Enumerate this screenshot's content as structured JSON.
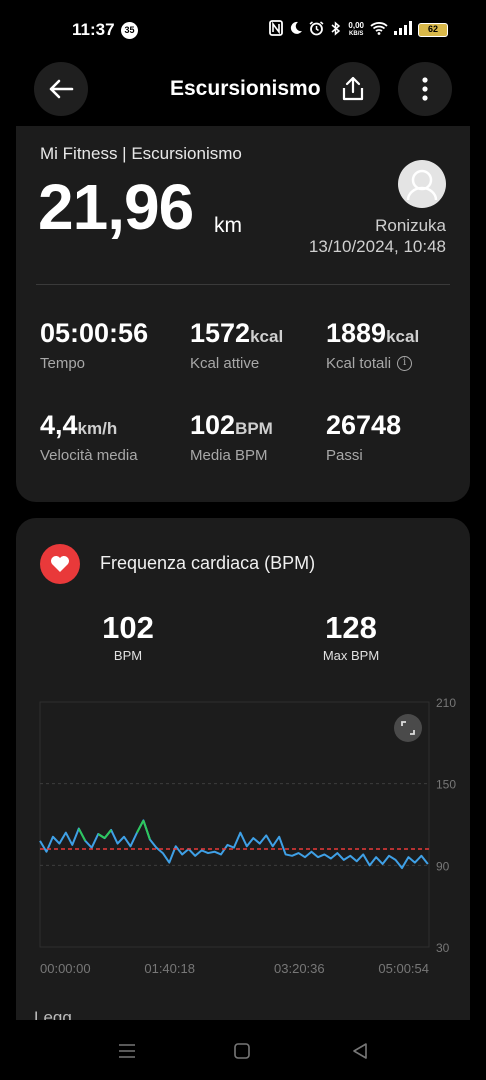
{
  "status_bar": {
    "time": "11:37",
    "notification_count": "35",
    "net_speed_value": "0,00",
    "net_speed_unit": "KB/S",
    "battery": "62"
  },
  "header": {
    "title": "Escursionismo",
    "back_icon": "arrow-left-icon",
    "share_icon": "share-icon",
    "more_icon": "more-vertical-icon"
  },
  "summary": {
    "subtitle": "Mi Fitness | Escursionismo",
    "distance": "21,96",
    "distance_unit": "km",
    "user": "Ronizuka",
    "datetime": "13/10/2024, 10:48",
    "stats": [
      {
        "value": "05:00:56",
        "unit": "",
        "label": "Tempo"
      },
      {
        "value": "1572",
        "unit": "kcal",
        "label": "Kcal attive"
      },
      {
        "value": "1889",
        "unit": "kcal",
        "label": "Kcal totali"
      },
      {
        "value": "4,4",
        "unit": "km/h",
        "label": "Velocità media"
      },
      {
        "value": "102",
        "unit": "BPM",
        "label": "Media BPM"
      },
      {
        "value": "26748",
        "unit": "",
        "label": "Passi"
      }
    ]
  },
  "heart_rate": {
    "title": "Frequenza cardiaca (BPM)",
    "avg_value": "102",
    "avg_label": "BPM",
    "max_value": "128",
    "max_label": "Max BPM",
    "legend_peek": "Legg",
    "accent_color": "#e9393a",
    "line_color": "#3fa0e6",
    "high_color": "#2ec95b"
  },
  "chart_data": {
    "type": "line",
    "title": "",
    "xlabel": "",
    "ylabel": "",
    "x_tick_labels": [
      "00:00:00",
      "01:40:18",
      "03:20:36",
      "05:00:54"
    ],
    "y_tick_labels": [
      "210",
      "150",
      "90",
      "30"
    ],
    "ylim": [
      30,
      210
    ],
    "xlim_seconds": [
      0,
      18054
    ],
    "average_line": 102,
    "series": [
      {
        "x_minutes": [
          0,
          5,
          10,
          15,
          20,
          25,
          30,
          35,
          40,
          45,
          50,
          55,
          60,
          65,
          70,
          75,
          80,
          85,
          90,
          95,
          100,
          105,
          110,
          115,
          120,
          125,
          130,
          135,
          140,
          145,
          150,
          155,
          160,
          165,
          170,
          175,
          180,
          185,
          190,
          195,
          200,
          205,
          210,
          215,
          220,
          225,
          230,
          235,
          240,
          245,
          250,
          255,
          260,
          265,
          270,
          275,
          280,
          285,
          290,
          295,
          300
        ],
        "values": [
          108,
          100,
          111,
          106,
          114,
          105,
          117,
          108,
          103,
          113,
          110,
          116,
          106,
          111,
          104,
          114,
          123,
          109,
          103,
          99,
          92,
          104,
          98,
          102,
          97,
          101,
          99,
          100,
          98,
          105,
          103,
          114,
          104,
          110,
          106,
          112,
          104,
          111,
          98,
          97,
          99,
          96,
          100,
          96,
          98,
          95,
          99,
          94,
          97,
          93,
          98,
          90,
          96,
          91,
          97,
          94,
          88,
          96,
          92,
          97,
          91
        ]
      }
    ]
  },
  "nav_bar": {
    "menu_icon": "menu-icon",
    "home_icon": "home-square-icon",
    "back_icon": "back-triangle-icon"
  }
}
